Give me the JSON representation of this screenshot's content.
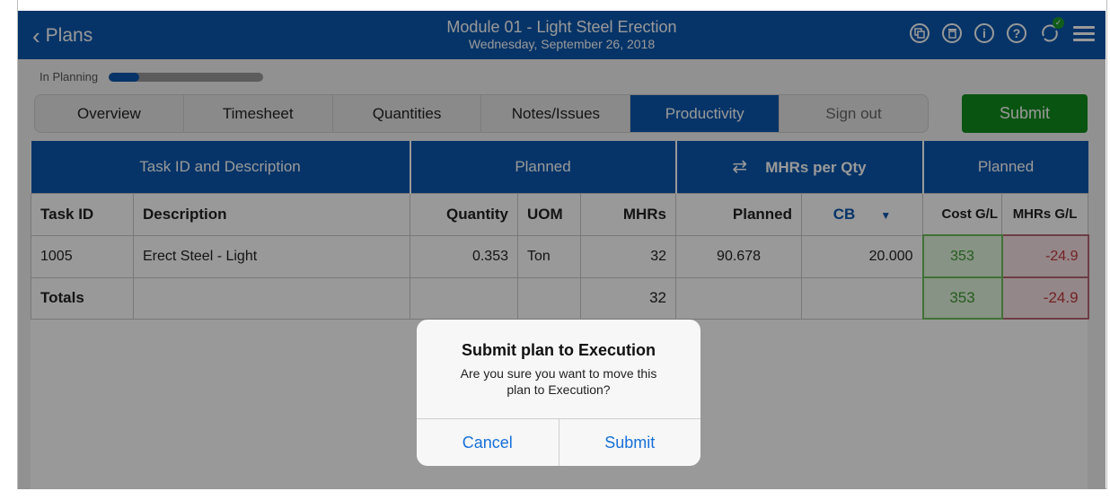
{
  "header": {
    "back_label": "Plans",
    "title": "Module 01 - Light Steel Erection",
    "subtitle": "Wednesday, September 26, 2018",
    "icons": [
      "copy-icon",
      "delete-icon",
      "info-icon",
      "help-icon",
      "sync-icon",
      "menu-icon"
    ]
  },
  "status": {
    "label": "In Planning",
    "progress": 0.2
  },
  "tabs": [
    "Overview",
    "Timesheet",
    "Quantities",
    "Notes/Issues",
    "Productivity",
    "Sign out"
  ],
  "active_tab": "Productivity",
  "submit_label": "Submit",
  "table": {
    "group_headers": {
      "task": "Task ID and Description",
      "planned": "Planned",
      "mhrs_per_qty": "MHRs per Qty",
      "planned2": "Planned"
    },
    "columns": {
      "task_id": "Task ID",
      "description": "Description",
      "quantity": "Quantity",
      "uom": "UOM",
      "mhrs": "MHRs",
      "planned": "Planned",
      "cb": "CB",
      "cost_gl": "Cost G/L",
      "mhrs_gl": "MHRs G/L"
    },
    "rows": [
      {
        "task_id": "1005",
        "description": "Erect Steel - Light",
        "quantity": "0.353",
        "uom": "Ton",
        "mhrs": "32",
        "planned": "90.678",
        "cb": "20.000",
        "cost_gl": "353",
        "mhrs_gl": "-24.9"
      }
    ],
    "totals": {
      "label": "Totals",
      "mhrs": "32",
      "cost_gl": "353",
      "mhrs_gl": "-24.9"
    }
  },
  "dialog": {
    "title": "Submit plan to Execution",
    "message": "Are you sure you want to move this plan to Execution?",
    "cancel": "Cancel",
    "confirm": "Submit"
  },
  "colors": {
    "primary": "#0b57ad",
    "success": "#128d1e",
    "positive": "#6bbf5c",
    "negative": "#b76776"
  }
}
